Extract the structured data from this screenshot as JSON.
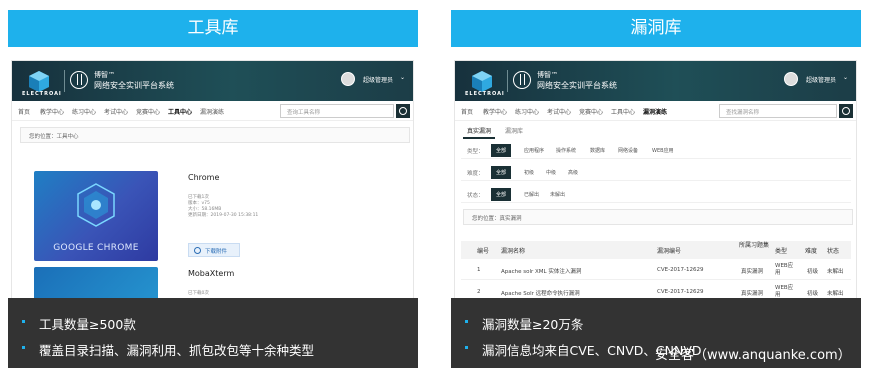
{
  "left": {
    "title": "工具库",
    "header": {
      "logo_text": "ELECTROAI",
      "brand_name": "博智™",
      "brand_sub": "网络安全实训平台系统",
      "user": "超级管理员"
    },
    "nav": [
      "首页",
      "教学中心",
      "练习中心",
      "考试中心",
      "竞赛中心",
      "工具中心",
      "漏洞演练"
    ],
    "nav_active": 5,
    "search_placeholder": "查询工具名称",
    "breadcrumb": "您的位置：工具中心",
    "tools": [
      {
        "name": "Chrome",
        "image_caption": "GOOGLE CHROME",
        "meta": [
          "已下载1次",
          "版本：v75",
          "大小：58.16MB",
          "更新日期：2019-07-30 15:38:11"
        ],
        "download_label": "下载附件"
      },
      {
        "name": "MobaXterm",
        "meta": [
          "已下载0次"
        ]
      }
    ],
    "bullets": [
      "工具数量≥500款",
      "覆盖目录扫描、漏洞利用、抓包改包等十余种类型"
    ]
  },
  "right": {
    "title": "漏洞库",
    "header": {
      "logo_text": "ELECTROAI",
      "brand_name": "博智™",
      "brand_sub": "网络安全实训平台系统",
      "user": "超级管理员"
    },
    "nav": [
      "首页",
      "教学中心",
      "练习中心",
      "考试中心",
      "竞赛中心",
      "工具中心",
      "漏洞演练"
    ],
    "nav_active": 6,
    "search_placeholder": "查找漏洞名称",
    "tabs": [
      "真实漏洞",
      "漏洞库"
    ],
    "filters": [
      {
        "label": "类型：",
        "options": [
          "全部",
          "应用程序",
          "操作系统",
          "数据库",
          "网络设备",
          "WEB应用"
        ]
      },
      {
        "label": "难度：",
        "options": [
          "全部",
          "初级",
          "中级",
          "高级"
        ]
      },
      {
        "label": "状态：",
        "options": [
          "全部",
          "已解出",
          "未解出"
        ]
      }
    ],
    "breadcrumb": "您的位置：真实漏洞",
    "table": {
      "headers": [
        "编号",
        "漏洞名称",
        "漏洞编号",
        "所属习题集",
        "类型",
        "难度",
        "状态"
      ],
      "rows": [
        [
          "1",
          "Apache solr XML 实体注入漏洞",
          "CVE-2017-12629",
          "真实漏洞",
          "WEB应用",
          "初级",
          "未解出"
        ],
        [
          "2",
          "Apache Solr 远程命令执行漏洞",
          "CVE-2017-12629",
          "真实漏洞",
          "WEB应用",
          "初级",
          "未解出"
        ]
      ]
    },
    "bullets": [
      "漏洞数量≥20万条",
      "漏洞信息均来自CVE、CNVD、CNNVD"
    ]
  },
  "watermark": "安全客（www.anquanke.com）"
}
